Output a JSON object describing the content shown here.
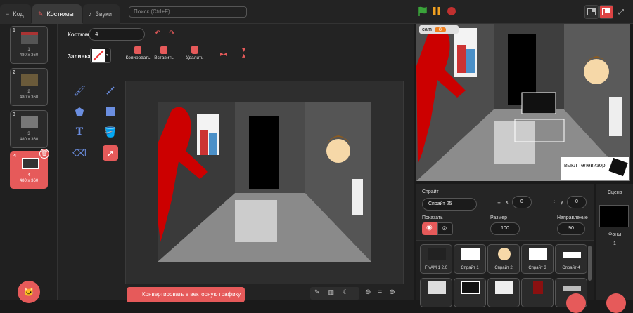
{
  "tabs": [
    {
      "label": "Код",
      "icon": "code-icon"
    },
    {
      "label": "Костюмы",
      "icon": "brush-icon"
    },
    {
      "label": "Звуки",
      "icon": "speaker-icon"
    }
  ],
  "search_placeholder": "Поиск (Ctrl+F)",
  "costumes": [
    {
      "num": "1",
      "name": "1",
      "size": "480 x 360"
    },
    {
      "num": "2",
      "name": "2",
      "size": "480 x 360"
    },
    {
      "num": "3",
      "name": "3",
      "size": "480 x 360"
    },
    {
      "num": "4",
      "name": "4",
      "size": "480 x 360"
    }
  ],
  "editor": {
    "costume_label": "Костюм",
    "costume_name": "4",
    "fill_label": "Заливка",
    "copy_label": "Копировать",
    "paste_label": "Вставить",
    "delete_label": "Удалить",
    "convert_button": "Конвертировать в векторную графику"
  },
  "stage": {
    "cam_label": "cam",
    "cam_value": "8",
    "tv_text": "выкл телевизор"
  },
  "sprite": {
    "sprite_label": "Спрайт",
    "sprite_name": "Спрайт 25",
    "x_label": "x",
    "x_value": "0",
    "y_label": "y",
    "y_value": "0",
    "show_label": "Показать",
    "size_label": "Размер",
    "size_value": "100",
    "direction_label": "Направление",
    "direction_value": "90",
    "tiles": [
      "FNAM 1 2.0",
      "Спрайт 1",
      "Спрайт 2",
      "Спрайт 3",
      "Спрайт 4"
    ]
  },
  "scene": {
    "label": "Сцена",
    "backdrops_label": "Фоны",
    "backdrops_count": "1"
  },
  "colors": {
    "accent": "#e65a5a",
    "tool_blue": "#6b8ee0",
    "flag_green": "#3aa33a",
    "pause_orange": "#f0a020"
  }
}
